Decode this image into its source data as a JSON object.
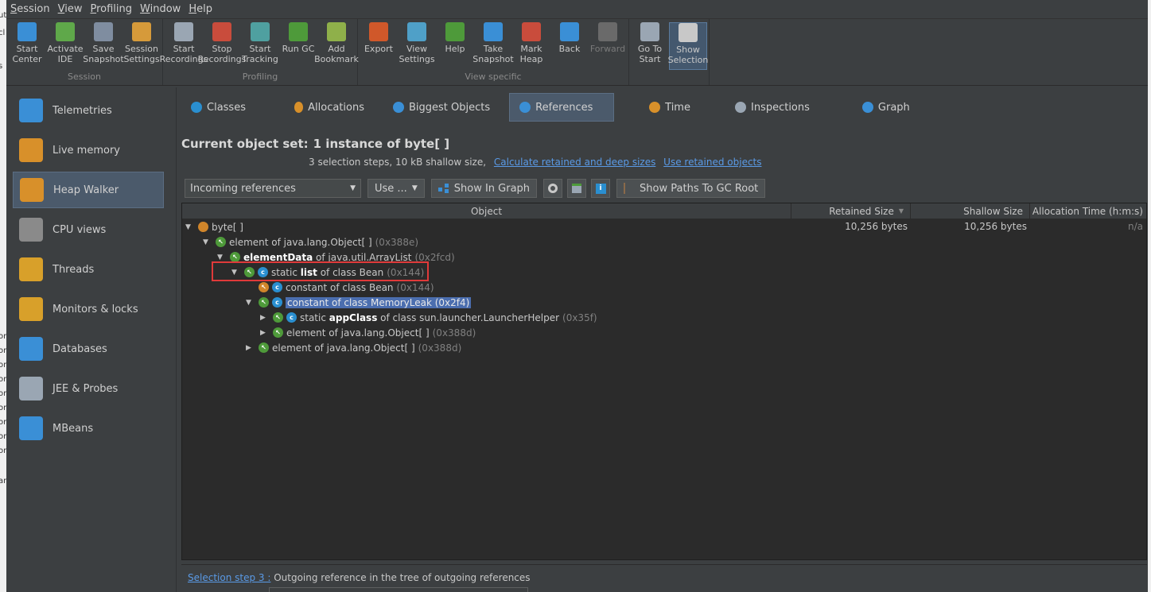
{
  "left_fragments": [
    "ut",
    "cl",
    "s",
    "or",
    "or",
    "or",
    "or",
    "or",
    "or",
    "or",
    "or",
    "or",
    "ar"
  ],
  "menubar": [
    "Session",
    "View",
    "Profiling",
    "Window",
    "Help"
  ],
  "toolbar": {
    "groups": [
      {
        "label": "Session",
        "buttons": [
          {
            "label": "Start\nCenter",
            "icon": "start-center-icon",
            "color": "#3a8fd6"
          },
          {
            "label": "Activate\nIDE",
            "icon": "activate-ide-icon",
            "color": "#5fa84a"
          },
          {
            "label": "Save\nSnapshot",
            "icon": "save-snapshot-icon",
            "color": "#7f8da0"
          },
          {
            "label": "Session\nSettings",
            "icon": "session-settings-icon",
            "color": "#d69a3a"
          }
        ]
      },
      {
        "label": "Profiling",
        "buttons": [
          {
            "label": "Start\nRecordings",
            "icon": "start-recordings-icon",
            "color": "#9aa6b3"
          },
          {
            "label": "Stop\nRecordings",
            "icon": "stop-recordings-icon",
            "color": "#c94c3c"
          },
          {
            "label": "Start\nTracking",
            "icon": "start-tracking-icon",
            "color": "#4fa0a0"
          },
          {
            "label": "Run GC",
            "icon": "run-gc-icon",
            "color": "#4e9a3a"
          },
          {
            "label": "Add\nBookmark",
            "icon": "add-bookmark-icon",
            "color": "#8fb04a"
          }
        ]
      },
      {
        "label": "View specific",
        "buttons": [
          {
            "label": "Export",
            "icon": "export-icon",
            "color": "#d0582a"
          },
          {
            "label": "View\nSettings",
            "icon": "view-settings-icon",
            "color": "#4fa0c8"
          },
          {
            "label": "Help",
            "icon": "help-icon",
            "color": "#4e9a3a"
          },
          {
            "label": "Take\nSnapshot",
            "icon": "take-snapshot-icon",
            "color": "#3a8fd6"
          },
          {
            "label": "Mark\nHeap",
            "icon": "mark-heap-icon",
            "color": "#c94c3c"
          },
          {
            "label": "Back",
            "icon": "back-icon",
            "color": "#3a8fd6"
          },
          {
            "label": "Forward",
            "icon": "forward-icon",
            "color": "#6a6a6a",
            "disabled": true
          }
        ]
      },
      {
        "label": "",
        "buttons": [
          {
            "label": "Go To\nStart",
            "icon": "go-to-start-icon",
            "color": "#9aa6b3"
          },
          {
            "label": "Show\nSelection",
            "icon": "show-selection-icon",
            "color": "#c8c8c8",
            "active": true
          }
        ]
      }
    ]
  },
  "sidebar": [
    {
      "label": "Telemetries",
      "icon": "telemetries-icon",
      "color": "#3a8fd6"
    },
    {
      "label": "Live memory",
      "icon": "live-memory-icon",
      "color": "#d8902a"
    },
    {
      "label": "Heap Walker",
      "icon": "heap-walker-icon",
      "color": "#d8902a",
      "active": true
    },
    {
      "label": "CPU views",
      "icon": "cpu-views-icon",
      "color": "#8a8a8a"
    },
    {
      "label": "Threads",
      "icon": "threads-icon",
      "color": "#d8a02a"
    },
    {
      "label": "Monitors & locks",
      "icon": "monitors-locks-icon",
      "color": "#d8a02a"
    },
    {
      "label": "Databases",
      "icon": "databases-icon",
      "color": "#3a8fd6"
    },
    {
      "label": "JEE & Probes",
      "icon": "jee-probes-icon",
      "color": "#9aa6b3"
    },
    {
      "label": "MBeans",
      "icon": "mbeans-icon",
      "color": "#3a8fd6"
    }
  ],
  "tabs": [
    {
      "label": "Classes",
      "icon": "classes-icon",
      "color": "#2a8fd0"
    },
    {
      "label": "Allocations",
      "icon": "allocations-icon",
      "color": "#d8902a"
    },
    {
      "label": "Biggest Objects",
      "icon": "biggest-objects-icon",
      "color": "#3a8fd6"
    },
    {
      "label": "References",
      "icon": "references-icon",
      "color": "#3a8fd6",
      "active": true
    },
    {
      "label": "Time",
      "icon": "time-icon",
      "color": "#d8902a"
    },
    {
      "label": "Inspections",
      "icon": "inspections-icon",
      "color": "#9aa6b3"
    },
    {
      "label": "Graph",
      "icon": "graph-icon",
      "color": "#3a8fd6"
    }
  ],
  "object_set": {
    "title_label": "Current object set:",
    "title_value": "1 instance of byte[ ]",
    "subtitle": "3 selection steps, 10 kB shallow size,",
    "link_calc": "Calculate retained and deep sizes",
    "link_use": "Use retained objects"
  },
  "controls": {
    "reference_mode": "Incoming references",
    "use_button": "Use ...",
    "show_in_graph": "Show In Graph",
    "show_paths": "Show Paths To GC Root"
  },
  "table": {
    "columns": [
      "Object",
      "Retained Size",
      "Shallow Size",
      "Allocation Time (h:m:s)"
    ],
    "root": {
      "label": "byte[ ]",
      "retained": "10,256 bytes",
      "shallow": "10,256 bytes",
      "alloc": "n/a"
    },
    "rows": [
      {
        "prefix": "element of java.lang.Object[ ]",
        "bold": "",
        "suffix": "",
        "addr": "(0x388e)"
      },
      {
        "prefix": "",
        "bold": "elementData",
        "suffix": " of java.util.ArrayList",
        "addr": "(0x2fcd)"
      },
      {
        "prefix": "static ",
        "bold": "list",
        "suffix": " of class Bean",
        "addr": "(0x144)"
      },
      {
        "prefix": "constant of class Bean",
        "bold": "",
        "suffix": "",
        "addr": "(0x144)"
      },
      {
        "prefix": "constant of class MemoryLeak (0x2f4)",
        "bold": "",
        "suffix": "",
        "addr": ""
      },
      {
        "prefix": "static ",
        "bold": "appClass",
        "suffix": " of class sun.launcher.LauncherHelper",
        "addr": "(0x35f)"
      },
      {
        "prefix": "element of java.lang.Object[ ]",
        "bold": "",
        "suffix": "",
        "addr": "(0x388d)"
      },
      {
        "prefix": "element of java.lang.Object[ ]",
        "bold": "",
        "suffix": "",
        "addr": "(0x388d)"
      }
    ]
  },
  "bottom": {
    "step_link": "Selection step 3 :",
    "step_text": " Outgoing reference in the tree of outgoing references"
  }
}
